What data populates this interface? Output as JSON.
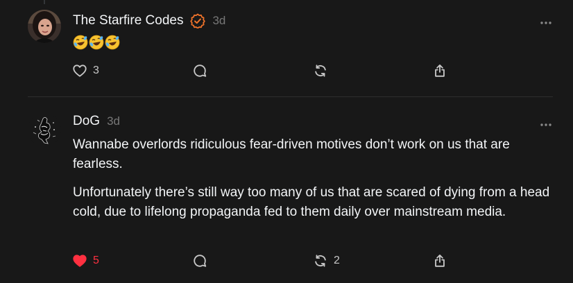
{
  "posts": [
    {
      "username": "The Starfire Codes",
      "verified": true,
      "time": "3d",
      "emojis": [
        "rolling-on-floor-laughing",
        "rolling-on-floor-laughing",
        "rolling-on-floor-laughing"
      ],
      "likes": "3",
      "liked": false,
      "replies": "",
      "reposts": ""
    },
    {
      "username": "DoG",
      "verified": false,
      "time": "3d",
      "paragraphs": [
        "Wannabe overlords ridiculous fear-driven motives don’t work on us that are fearless.",
        "Unfortunately there’s still way too many of us that are scared of dying from a head cold, due to lifelong propaganda fed to them daily over mainstream media."
      ],
      "likes": "5",
      "liked": true,
      "replies": "",
      "reposts": "2"
    }
  ],
  "icons": {
    "like": "heart-icon",
    "reply": "comment-icon",
    "repost": "repost-icon",
    "share": "share-icon",
    "more": "more-icon",
    "verified": "verified-badge-icon"
  },
  "colors": {
    "background": "#181818",
    "text": "#f3f5f7",
    "muted": "#777777",
    "like_active": "#ff3040",
    "verified": "#f0732a",
    "divider": "#2e2e2e"
  }
}
